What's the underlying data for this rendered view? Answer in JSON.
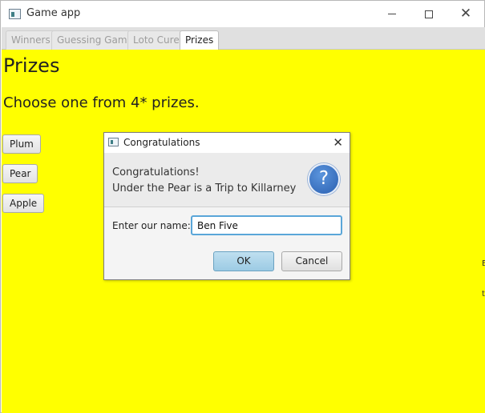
{
  "window": {
    "title": "Game app",
    "icon": "app-window-icon"
  },
  "tabs": [
    {
      "label": "Winners",
      "active": false
    },
    {
      "label": "Guessing Game",
      "active": false
    },
    {
      "label": "Loto Cure",
      "active": false
    },
    {
      "label": "Prizes",
      "active": true
    }
  ],
  "main": {
    "heading": "Prizes",
    "subheading": "Choose one from 4* prizes.",
    "buttons": [
      "Plum",
      "Pear",
      "Apple"
    ],
    "background_color": "#ffff00"
  },
  "dialog": {
    "title": "Congratulations",
    "message_line1": "Congratulations!",
    "message_line2": "Under the Pear is a Trip to Killarney",
    "icon": "question-icon",
    "input_label": "Enter our name:",
    "input_value": "Ben Five",
    "ok_label": "OK",
    "cancel_label": "Cancel"
  }
}
